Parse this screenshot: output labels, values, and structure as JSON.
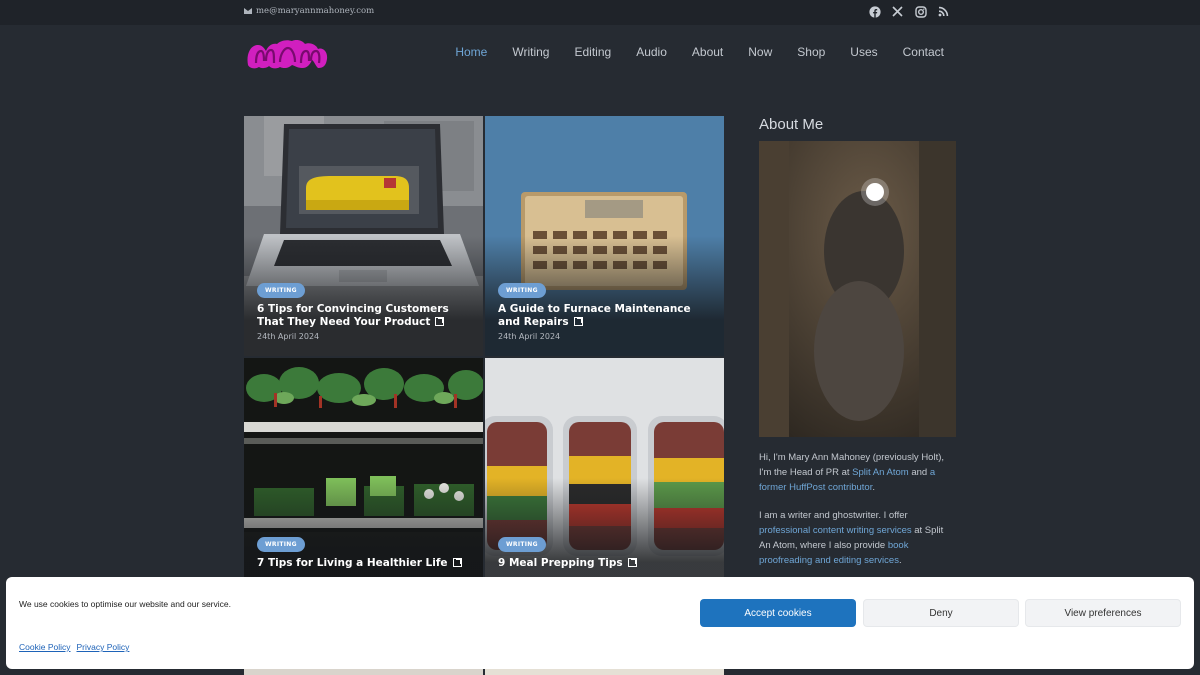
{
  "topbar": {
    "email": "me@maryannmahoney.com",
    "social_icons": [
      "facebook-icon",
      "x-icon",
      "instagram-icon",
      "rss-icon"
    ]
  },
  "nav": {
    "items": [
      {
        "label": "Home"
      },
      {
        "label": "Writing"
      },
      {
        "label": "Editing"
      },
      {
        "label": "Audio"
      },
      {
        "label": "About"
      },
      {
        "label": "Now"
      },
      {
        "label": "Shop"
      },
      {
        "label": "Uses"
      },
      {
        "label": "Contact"
      }
    ],
    "active": "Home"
  },
  "posts": [
    {
      "category": "WRITING",
      "title": "6 Tips for Convincing Customers That They Need Your Product",
      "date": "24th April 2024"
    },
    {
      "category": "WRITING",
      "title": "A Guide to Furnace Maintenance and Repairs",
      "date": "24th April 2024"
    },
    {
      "category": "WRITING",
      "title": "7 Tips for Living a Healthier Life",
      "date": ""
    },
    {
      "category": "WRITING",
      "title": "9 Meal Prepping Tips",
      "date": ""
    }
  ],
  "sidebar": {
    "title": "About Me",
    "bio1": {
      "t1": "Hi, I'm Mary Ann Mahoney (previously Holt), I'm the Head of PR at ",
      "link1": "Split An Atom",
      "t2": " and ",
      "link2": "a former HuffPost contributor",
      "t3": "."
    },
    "bio2": {
      "t1": "I am a writer and ghostwriter. I offer ",
      "link1": "professional content writing services",
      "t2": " at Split An Atom, where I also provide ",
      "link2": "book proofreading and editing services",
      "t3": "."
    }
  },
  "cookie": {
    "message": "We use cookies to optimise our website and our service.",
    "accept": "Accept cookies",
    "deny": "Deny",
    "preferences": "View preferences",
    "cookie_policy": "Cookie Policy",
    "privacy_policy": "Privacy Policy"
  },
  "colors": {
    "background": "#262b32",
    "topbar": "#1f2329",
    "accent": "#6fa6d6",
    "badge": "#6d9ed3",
    "logo": "#d11fbf",
    "accept_button": "#1e73be"
  }
}
